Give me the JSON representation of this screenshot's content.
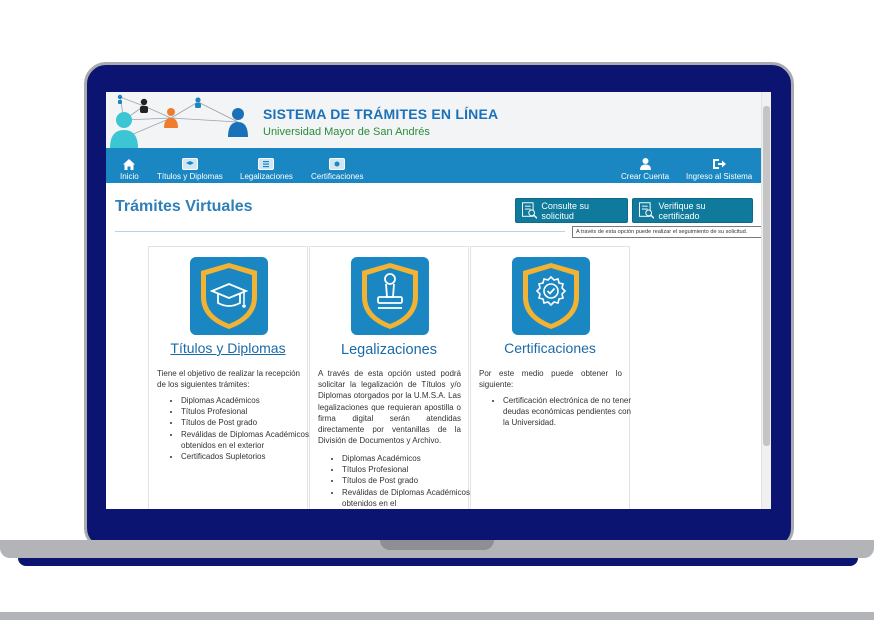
{
  "header": {
    "title": "SISTEMA DE TRÁMITES EN LÍNEA",
    "subtitle": "Universidad Mayor de San Andrés"
  },
  "nav": {
    "items": [
      {
        "label": "Inicio",
        "icon": "home-icon"
      },
      {
        "label": "Títulos y Diplomas",
        "icon": "diploma-icon"
      },
      {
        "label": "Legalizaciones",
        "icon": "document-icon"
      },
      {
        "label": "Certificaciones",
        "icon": "certificate-icon"
      }
    ],
    "right": [
      {
        "label": "Crear Cuenta",
        "icon": "user-icon"
      },
      {
        "label": "Ingreso al Sistema",
        "icon": "sign-in-icon"
      }
    ]
  },
  "main": {
    "title": "Trámites Virtuales",
    "buttons": {
      "consult": "Consulte su solicitud",
      "verify": "Verifique su certificado"
    },
    "tooltip": "A través de esta opción puede realizar el seguimiento de su solicitud."
  },
  "cards": [
    {
      "title": "Títulos y Diplomas",
      "icon": "graduation-cap-icon",
      "description": "Tiene el objetivo de realizar la recepción de los siguientes trámites:",
      "items": [
        "Diplomas Académicos",
        "Títulos Profesional",
        "Títulos de Post grado",
        "Reválidas de Diplomas Académicos obtenidos en el exterior",
        "Certificados Supletorios"
      ]
    },
    {
      "title": "Legalizaciones",
      "icon": "stamp-icon",
      "description": "A través de esta opción usted podrá solicitar la legalización de Títulos y/o Diplomas otorgados por la U.M.S.A. Las legalizaciones que requieran apostilla o firma digital serán atendidas directamente por ventanillas de la División de Documentos y Archivo.",
      "items": [
        "Diplomas Académicos",
        "Títulos Profesional",
        "Títulos de Post grado",
        "Reválidas de Diplomas Académicos obtenidos en el"
      ]
    },
    {
      "title": "Certificaciones",
      "icon": "seal-check-icon",
      "description": "Por este medio puede obtener lo siguiente:",
      "items": [
        "Certificación electrónica de no tener deudas económicas pendientes con la Universidad."
      ]
    }
  ],
  "colors": {
    "nav_bg": "#1a86c2",
    "title_blue": "#1b71b9",
    "subtitle_green": "#2e8b3a",
    "button_bg": "#0f7a9c",
    "laptop_frame": "#0b1470",
    "shield_gold": "#f2b233"
  }
}
